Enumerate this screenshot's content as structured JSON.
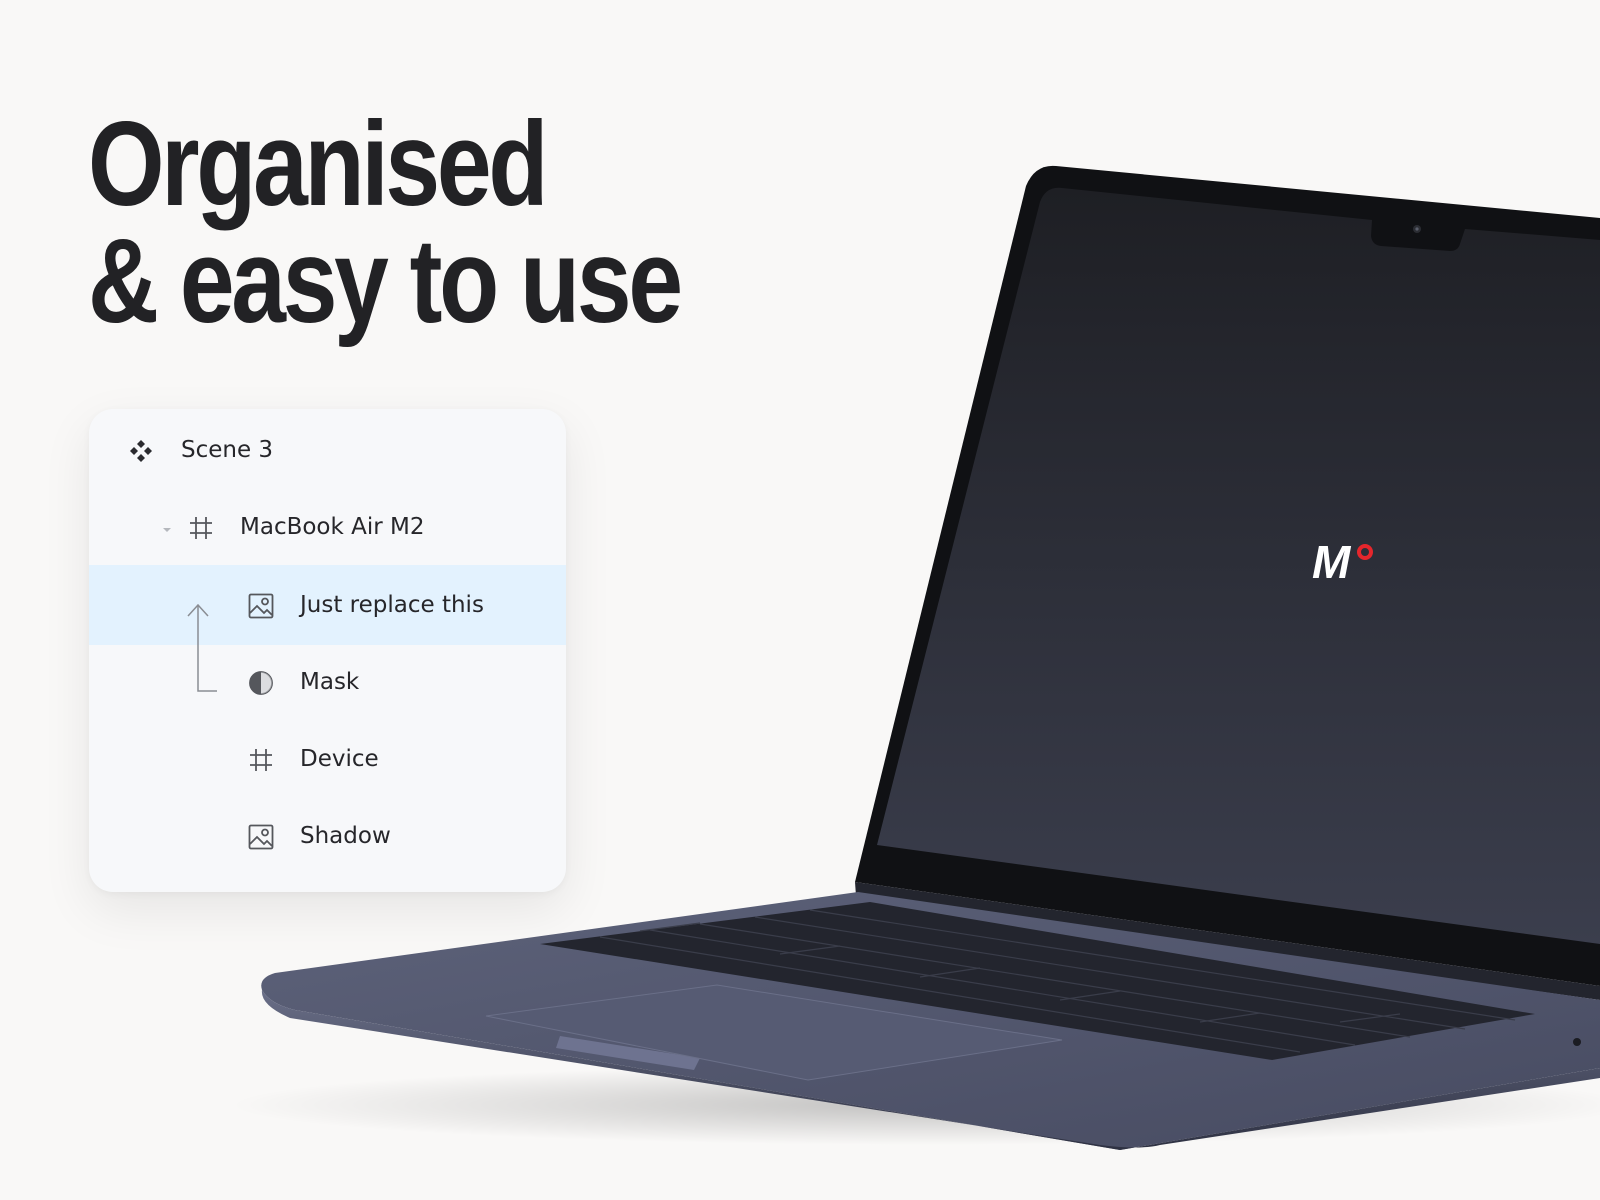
{
  "headline": {
    "line1": "Organised",
    "line2": "& easy to use"
  },
  "layers_panel": {
    "items": [
      {
        "label": "Scene 3",
        "icon": "components-icon",
        "level": 0
      },
      {
        "label": "MacBook Air M2",
        "icon": "frame-icon",
        "level": 1,
        "expanded": true
      },
      {
        "label": "Just replace this",
        "icon": "image-icon",
        "level": 2,
        "selected": true
      },
      {
        "label": "Mask",
        "icon": "mask-icon",
        "level": 2
      },
      {
        "label": "Device",
        "icon": "frame-icon",
        "level": 2
      },
      {
        "label": "Shadow",
        "icon": "image-icon",
        "level": 2
      }
    ]
  },
  "screen": {
    "logo": "M"
  },
  "colors": {
    "background": "#f9f8f7",
    "headline": "#222225",
    "selection": "#e3f2fe",
    "laptop_body": "#4b5068",
    "logo_accent": "#e5262c"
  }
}
